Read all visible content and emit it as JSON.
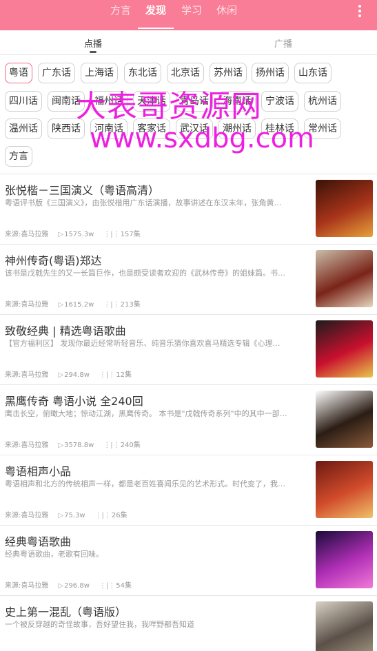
{
  "top_tabs": [
    "方言",
    "发现",
    "学习",
    "休闲"
  ],
  "sub_tabs": [
    "点播",
    "广播"
  ],
  "dialects": [
    "粤语",
    "广东话",
    "上海话",
    "东北话",
    "北京话",
    "苏州话",
    "扬州话",
    "山东话",
    "四川话",
    "闽南话",
    "福州话",
    "天津话",
    "青岛话",
    "海南话",
    "宁波话",
    "杭州话",
    "温州话",
    "陕西话",
    "河南话",
    "客家话",
    "武汉话",
    "潮州话",
    "桂林话",
    "常州话",
    "方言"
  ],
  "watermark": {
    "line1": "大表哥资源网",
    "line2": "www.sxdbg.com"
  },
  "items": [
    {
      "title": "张悦楷－三国演义（粤语高清）",
      "desc": "粤语评书版《三国演义》，由张悦楷用广东话演播，故事讲述在东汉末年，张角黄…",
      "source": "来源:喜马拉雅",
      "plays": "1575.3w",
      "episodes": "157集",
      "thumb_colors": [
        "#3a1208",
        "#a8341a",
        "#e7a23c"
      ]
    },
    {
      "title": "神州传奇(粤语)郑达",
      "desc": "该书是戊戟先生的又一长篇巨作，也是颇受读者欢迎的《武林传奇》的姐妹篇。书…",
      "source": "来源:喜马拉雅",
      "plays": "1615.2w",
      "episodes": "213集",
      "thumb_colors": [
        "#c9bda9",
        "#7a2418",
        "#e6d6bf"
      ]
    },
    {
      "title": "致敬经典 | 精选粤语歌曲",
      "desc": "【官方福利区】 发现你最近经常听轻音乐、纯音乐猜你喜欢喜马精选专辑《心理…",
      "source": "来源:喜马拉雅",
      "plays": "294.8w",
      "episodes": "12集",
      "thumb_colors": [
        "#1c1c1c",
        "#c8102e",
        "#e8c64a"
      ]
    },
    {
      "title": "黑鹰传奇 粤语小说 全240回",
      "desc": "鹰击长空，俯瞰大地；惊动江湖，黑鹰传奇。 本书是\"戊戟传奇系列\"中的其中一部…",
      "source": "来源:喜马拉雅",
      "plays": "3578.8w",
      "episodes": "240集",
      "thumb_colors": [
        "#ffffff",
        "#2b1d14",
        "#8a5a3a"
      ]
    },
    {
      "title": "粤语相声小品",
      "desc": "粤语相声和北方的传统相声一样，都是老百姓喜闻乐见的艺术形式。时代变了，我…",
      "source": "来源:喜马拉雅",
      "plays": "75.3w",
      "episodes": "26集",
      "thumb_colors": [
        "#6b1a12",
        "#d14b2b",
        "#f0c16a"
      ]
    },
    {
      "title": "经典粤语歌曲",
      "desc": "经典粤语歌曲，老歌有回味。",
      "source": "来源:喜马拉雅",
      "plays": "296.8w",
      "episodes": "54集",
      "thumb_colors": [
        "#1a0b3a",
        "#b02fb6",
        "#f07ad8"
      ]
    },
    {
      "title": "史上第一混乱（粤语版）",
      "desc": "一个被反穿越的奇怪故事，吾好望住我，我咩野都吾知道",
      "source": "来源:喜马拉雅",
      "plays": "",
      "episodes": "",
      "thumb_colors": [
        "#d9d2c4",
        "#5a5048",
        "#a89a84"
      ]
    }
  ]
}
